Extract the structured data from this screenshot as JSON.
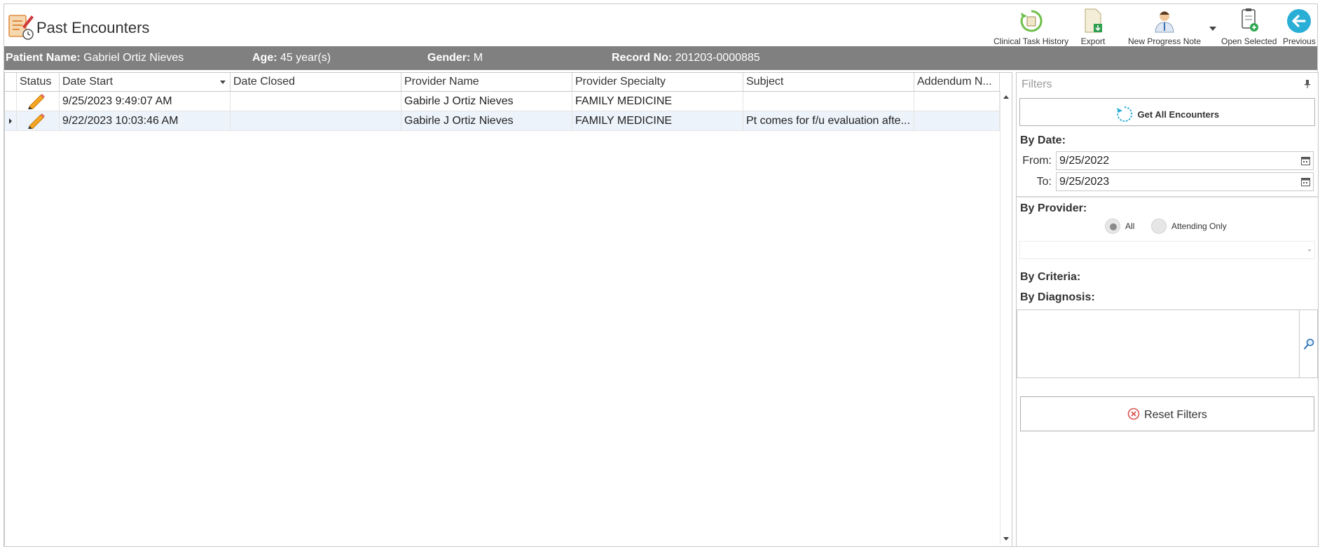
{
  "header": {
    "title": "Past Encounters",
    "toolbar": {
      "clinical_task_history": "Clinical Task History",
      "export": "Export",
      "new_progress_note": "New Progress Note",
      "open_selected": "Open Selected",
      "previous": "Previous"
    }
  },
  "patient": {
    "name_label": "Patient Name:",
    "name": "Gabriel Ortiz Nieves",
    "age_label": "Age:",
    "age": "45 year(s)",
    "gender_label": "Gender:",
    "gender": "M",
    "record_label": "Record No:",
    "record": "201203-0000885"
  },
  "grid": {
    "columns": [
      "Status",
      "Date Start",
      "Date Closed",
      "Provider Name",
      "Provider Specialty",
      "Subject",
      "Addendum N..."
    ],
    "rows": [
      {
        "date_start": "9/25/2023 9:49:07 AM",
        "date_closed": "",
        "provider": "Gabirle J Ortiz Nieves",
        "specialty": "FAMILY MEDICINE",
        "subject": "",
        "addendum": ""
      },
      {
        "date_start": "9/22/2023 10:03:46 AM",
        "date_closed": "",
        "provider": "Gabirle J Ortiz Nieves",
        "specialty": "FAMILY MEDICINE",
        "subject": "Pt comes for f/u evaluation afte...",
        "addendum": ""
      }
    ]
  },
  "filters": {
    "title": "Filters",
    "get_all": "Get All Encounters",
    "by_date": "By Date:",
    "from_label": "From:",
    "from_value": "9/25/2022",
    "to_label": "To:",
    "to_value": "9/25/2023",
    "by_provider": "By Provider:",
    "radio_all": "All",
    "radio_attending": "Attending Only",
    "by_criteria": "By Criteria:",
    "by_diagnosis": "By Diagnosis:",
    "reset": "Reset Filters"
  },
  "colors": {
    "patient_bar": "#808080",
    "selected_row": "#ecf3fb",
    "accent_teal": "#27a9c9",
    "reset_red": "#d9534f"
  }
}
